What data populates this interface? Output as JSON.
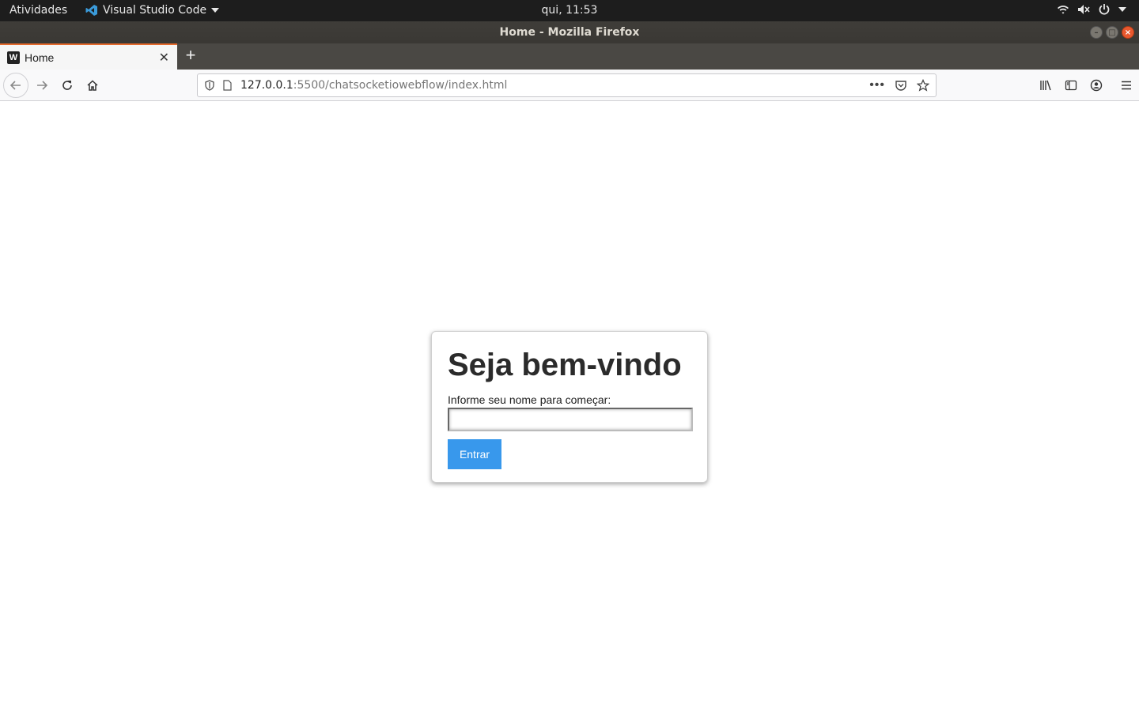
{
  "system_bar": {
    "activities": "Atividades",
    "app_name": "Visual Studio Code",
    "clock": "qui, 11:53"
  },
  "window": {
    "title": "Home - Mozilla Firefox"
  },
  "browser": {
    "tab_title": "Home",
    "url_host": "127.0.0.1",
    "url_rest": ":5500/chatsocketiowebflow/index.html"
  },
  "page": {
    "heading": "Seja bem-vindo",
    "name_label": "Informe seu nome para começar:",
    "name_value": "",
    "submit_label": "Entrar"
  }
}
